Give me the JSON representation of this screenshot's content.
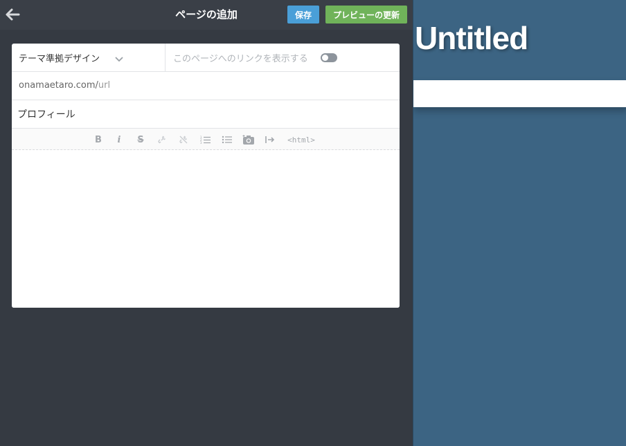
{
  "header": {
    "title": "ページの追加",
    "back_icon": "arrow-left-icon",
    "save_label": "保存",
    "preview_label": "プレビューの更新",
    "save_color": "#4a9fd8",
    "preview_color": "#70b35a"
  },
  "form": {
    "design_select": "テーマ準拠デザイン",
    "link_toggle_label": "このページへのリンクを表示する",
    "link_toggle_on": false,
    "url_domain": "onamaetaro.com/",
    "url_slug": "url",
    "page_title_value": "プロフィール"
  },
  "toolbar": {
    "bold": "B",
    "italic": "i",
    "strike": "S",
    "html": "<html>",
    "icons": [
      "bold-icon",
      "italic-icon",
      "strikethrough-icon",
      "link-icon",
      "unlink-icon",
      "ordered-list-icon",
      "unordered-list-icon",
      "camera-icon",
      "indent-icon",
      "html-icon"
    ]
  },
  "preview": {
    "site_title": "Untitled",
    "bg_color": "#3c6483"
  }
}
